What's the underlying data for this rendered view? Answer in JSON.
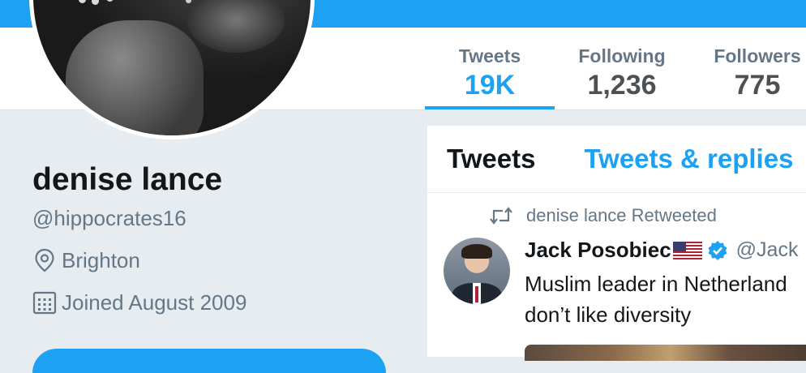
{
  "profile": {
    "name": "denise lance",
    "handle": "@hippocrates16",
    "location": "Brighton",
    "joined": "Joined August 2009"
  },
  "stats": [
    {
      "label": "Tweets",
      "value": "19K"
    },
    {
      "label": "Following",
      "value": "1,236"
    },
    {
      "label": "Followers",
      "value": "775"
    }
  ],
  "timeline": {
    "tabs": [
      {
        "label": "Tweets"
      },
      {
        "label": "Tweets & replies"
      }
    ],
    "tweet": {
      "retweet_context": "denise lance Retweeted",
      "author": "Jack Posobiec",
      "author_handle": "@Jack",
      "text_line1": "Muslim leader in Netherland",
      "text_line2": "don’t like diversity"
    }
  },
  "colors": {
    "accent": "#1da1f2",
    "text": "#14171a",
    "muted": "#657786",
    "background": "#e6ecf0"
  },
  "icons": {
    "location": "location-pin-icon",
    "joined": "calendar-icon",
    "retweet": "retweet-icon",
    "verified": "verified-badge-icon",
    "flag": "us-flag-icon"
  }
}
